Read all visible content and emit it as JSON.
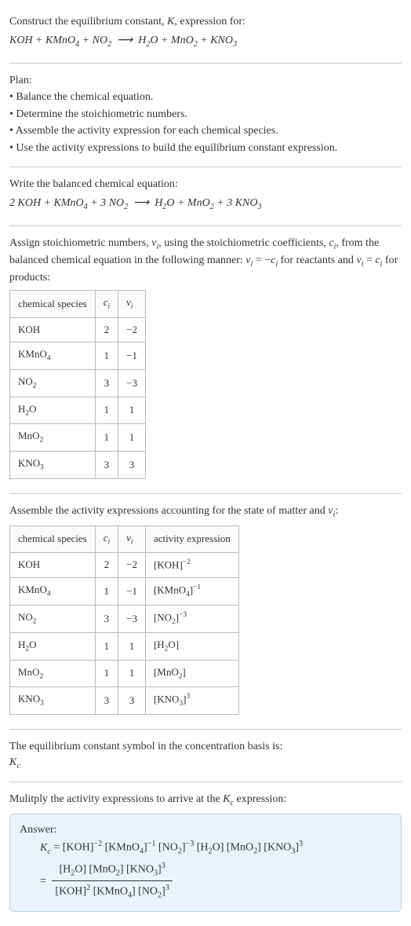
{
  "header": {
    "line1": "Construct the equilibrium constant, <i>K</i>, expression for:",
    "eq1": "KOH + KMnO<sub>4</sub> + NO<sub>2</sub> &nbsp;&longrightarrow;&nbsp; H<sub>2</sub>O + MnO<sub>2</sub> + KNO<sub>3</sub>"
  },
  "plan": {
    "title": "Plan:",
    "items": [
      "&bull; Balance the chemical equation.",
      "&bull; Determine the stoichiometric numbers.",
      "&bull; Assemble the activity expression for each chemical species.",
      "&bull; Use the activity expressions to build the equilibrium constant expression."
    ]
  },
  "balanced": {
    "title": "Write the balanced chemical equation:",
    "eq": "2 KOH + KMnO<sub>4</sub> + 3 NO<sub>2</sub> &nbsp;&longrightarrow;&nbsp; H<sub>2</sub>O + MnO<sub>2</sub> + 3 KNO<sub>3</sub>"
  },
  "assign": {
    "text": "Assign stoichiometric numbers, <i>&nu;<sub>i</sub></i>, using the stoichiometric coefficients, <i>c<sub>i</sub></i>, from the balanced chemical equation in the following manner: <i>&nu;<sub>i</sub></i> = &minus;<i>c<sub>i</sub></i> for reactants and <i>&nu;<sub>i</sub></i> = <i>c<sub>i</sub></i> for products:"
  },
  "table1": {
    "headers": [
      "chemical species",
      "<i>c<sub>i</sub></i>",
      "<i>&nu;<sub>i</sub></i>"
    ],
    "rows": [
      [
        "KOH",
        "2",
        "&minus;2"
      ],
      [
        "KMnO<sub>4</sub>",
        "1",
        "&minus;1"
      ],
      [
        "NO<sub>2</sub>",
        "3",
        "&minus;3"
      ],
      [
        "H<sub>2</sub>O",
        "1",
        "1"
      ],
      [
        "MnO<sub>2</sub>",
        "1",
        "1"
      ],
      [
        "KNO<sub>3</sub>",
        "3",
        "3"
      ]
    ]
  },
  "assemble": {
    "text": "Assemble the activity expressions accounting for the state of matter and <i>&nu;<sub>i</sub></i>:"
  },
  "table2": {
    "headers": [
      "chemical species",
      "<i>c<sub>i</sub></i>",
      "<i>&nu;<sub>i</sub></i>",
      "activity expression"
    ],
    "rows": [
      [
        "KOH",
        "2",
        "&minus;2",
        "[KOH]<sup>&minus;2</sup>"
      ],
      [
        "KMnO<sub>4</sub>",
        "1",
        "&minus;1",
        "[KMnO<sub>4</sub>]<sup>&minus;1</sup>"
      ],
      [
        "NO<sub>2</sub>",
        "3",
        "&minus;3",
        "[NO<sub>2</sub>]<sup>&minus;3</sup>"
      ],
      [
        "H<sub>2</sub>O",
        "1",
        "1",
        "[H<sub>2</sub>O]"
      ],
      [
        "MnO<sub>2</sub>",
        "1",
        "1",
        "[MnO<sub>2</sub>]"
      ],
      [
        "KNO<sub>3</sub>",
        "3",
        "3",
        "[KNO<sub>3</sub>]<sup>3</sup>"
      ]
    ]
  },
  "symbol": {
    "text": "The equilibrium constant symbol in the concentration basis is:",
    "kc": "<i>K<sub>c</sub></i>"
  },
  "multiply": {
    "text": "Mulitply the activity expressions to arrive at the <i>K<sub>c</sub></i> expression:"
  },
  "answer": {
    "label": "Answer:",
    "line1": "<i>K<sub>c</sub></i> = [KOH]<sup>&minus;2</sup> [KMnO<sub>4</sub>]<sup>&minus;1</sup> [NO<sub>2</sub>]<sup>&minus;3</sup> [H<sub>2</sub>O] [MnO<sub>2</sub>] [KNO<sub>3</sub>]<sup>3</sup>",
    "eq_prefix": "= ",
    "num": "[H<sub>2</sub>O] [MnO<sub>2</sub>] [KNO<sub>3</sub>]<sup>3</sup>",
    "den": "[KOH]<sup>2</sup> [KMnO<sub>4</sub>] [NO<sub>2</sub>]<sup>3</sup>"
  }
}
